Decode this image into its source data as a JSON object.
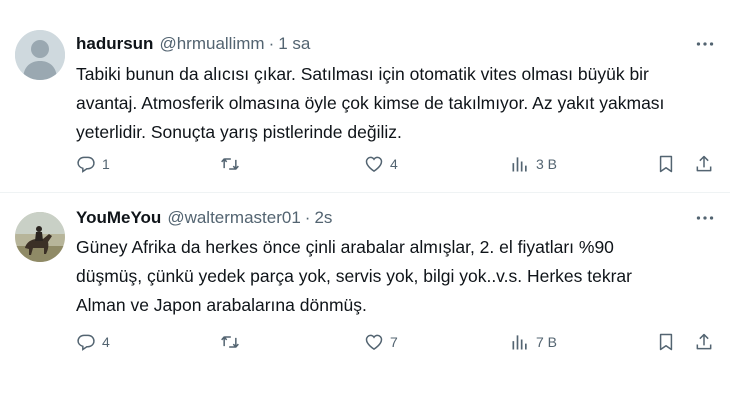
{
  "tweets": [
    {
      "author_name": "hadursun",
      "handle": "@hrmuallimm",
      "separator": "·",
      "time": "1 sa",
      "text": "Tabiki bunun da alıcısı çıkar. Satılması için otomatik vites olması büyük bir\navantaj. Atmosferik olmasına öyle çok kimse de takılmıyor. Az yakıt yakması\nyeterlidir. Sonuçta yarış pistlerinde değiliz.",
      "replies": "1",
      "retweets": "",
      "likes": "4",
      "views": "3 B",
      "avatar": "default-avatar"
    },
    {
      "author_name": "YouMeYou",
      "handle": "@waltermaster01",
      "separator": "·",
      "time": "2s",
      "text": "Güney Afrika da herkes önce çinli arabalar almışlar, 2. el fiyatları %90\ndüşmüş, çünkü yedek parça yok, servis yok, bilgi yok..v.s. Herkes tekrar\nAlman ve Japon arabalarına dönmüş.",
      "replies": "4",
      "retweets": "",
      "likes": "7",
      "views": "7 B",
      "avatar": "horse-rider-photo"
    }
  ],
  "icons": [
    "more-icon",
    "reply-icon",
    "retweet-icon",
    "like-icon",
    "views-icon",
    "bookmark-icon",
    "share-icon"
  ],
  "colors": {
    "text": "#0f1419",
    "secondary": "#536471",
    "divider": "#eff3f4",
    "avatar_placeholder": "#cfd9de"
  }
}
